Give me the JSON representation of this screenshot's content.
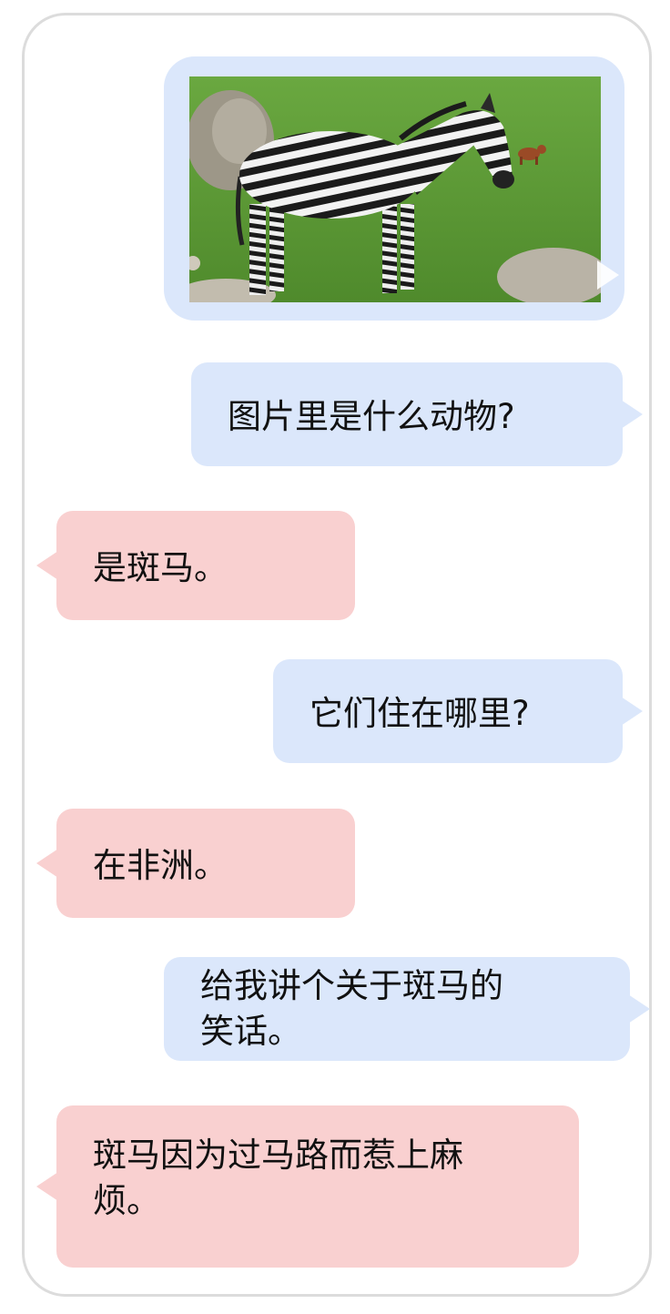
{
  "conversation": {
    "image": {
      "icon": "play-icon"
    },
    "messages": [
      {
        "role": "user",
        "text": "图片里是什么动物?"
      },
      {
        "role": "assistant",
        "text": "是斑马。"
      },
      {
        "role": "user",
        "text": "它们住在哪里?"
      },
      {
        "role": "assistant",
        "text": "在非洲。"
      },
      {
        "role": "user",
        "lines": [
          "给我讲个关于斑马的",
          "笑话。"
        ]
      },
      {
        "role": "assistant",
        "lines": [
          "斑马因为过马路而惹上麻",
          "烦。"
        ]
      }
    ]
  },
  "colors": {
    "user_bubble": "#dbe7fb",
    "assistant_bubble": "#f9d0d0",
    "frame_border": "#dcdcdc"
  }
}
